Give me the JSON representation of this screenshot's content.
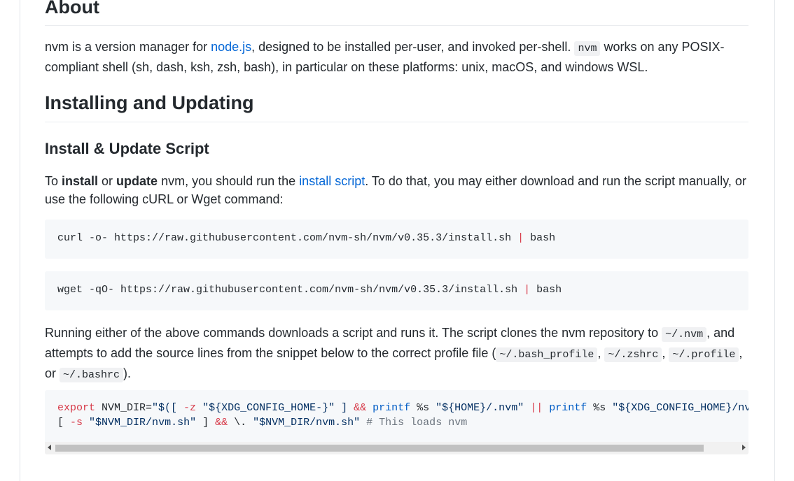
{
  "about": {
    "title": "About",
    "p1_a": "nvm is a version manager for ",
    "link_node": "node.js",
    "p1_b": ", designed to be installed per-user, and invoked per-shell. ",
    "code_nvm": "nvm",
    "p1_c": " works on any POSIX-compliant shell (sh, dash, ksh, zsh, bash), in particular on these platforms: unix, macOS, and windows WSL."
  },
  "installing": {
    "title": "Installing and Updating"
  },
  "script_section": {
    "title": "Install & Update Script",
    "p_to": "To ",
    "p_install": "install",
    "p_or": " or ",
    "p_update": "update",
    "p_mid": " nvm, you should run the ",
    "link_script": "install script",
    "p_end": ". To do that, you may either download and run the script manually, or use the following cURL or Wget command:"
  },
  "curl_cmd": {
    "cmd": "curl -o- https://raw.githubusercontent.com/nvm-sh/nvm/v0.35.3/install.sh ",
    "pipe": "|",
    "tail": " bash"
  },
  "wget_cmd": {
    "cmd": "wget -qO- https://raw.githubusercontent.com/nvm-sh/nvm/v0.35.3/install.sh ",
    "pipe": "|",
    "tail": " bash"
  },
  "running": {
    "a": "Running either of the above commands downloads a script and runs it. The script clones the nvm repository to ",
    "code_nvm_dir": "~/.nvm",
    "b": ", and attempts to add the source lines from the snippet below to the correct profile file (",
    "code_bash_profile": "~/.bash_profile",
    "c": ", ",
    "code_zshrc": "~/.zshrc",
    "d": ", ",
    "code_profile": "~/.profile",
    "e": ", or ",
    "code_bashrc": "~/.bashrc",
    "f": ")."
  },
  "snippet": {
    "l1_export": "export",
    "l1_a": " NVM_DIR=",
    "l1_b": "\"$([ ",
    "l1_z": "-z",
    "l1_c": " \"${XDG_CONFIG_HOME-}\" ] ",
    "l1_and": "&&",
    "l1_d": " ",
    "l1_printf1": "printf",
    "l1_e": " %s ",
    "l1_f": "\"${HOME}/.nvm\"",
    "l1_g": " ",
    "l1_or": "||",
    "l1_h": " ",
    "l1_printf2": "printf",
    "l1_i": " %s ",
    "l1_j": "\"${XDG_CONFIG_HOME}/nvm\")\"",
    "l2_a": "[ ",
    "l2_s": "-s",
    "l2_b": " ",
    "l2_c": "\"$NVM_DIR/nvm.sh\"",
    "l2_d": " ] ",
    "l2_and": "&&",
    "l2_e": " \\. ",
    "l2_f": "\"$NVM_DIR/nvm.sh\"",
    "l2_g": " ",
    "l2_comment": "# This loads nvm"
  }
}
